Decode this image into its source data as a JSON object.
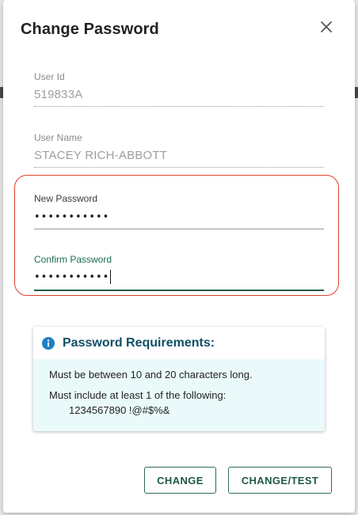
{
  "dialog": {
    "title": "Change Password"
  },
  "fields": {
    "user_id": {
      "label": "User Id",
      "value": "519833A"
    },
    "user_name": {
      "label": "User Name",
      "value": "STACEY RICH-ABBOTT"
    },
    "new_password": {
      "label": "New Password",
      "value": "•••••••••••"
    },
    "confirm_password": {
      "label": "Confirm Password",
      "value": "•••••••••••"
    }
  },
  "requirements": {
    "title": "Password Requirements:",
    "length_rule": "Must be between 10 and 20 characters long.",
    "char_rule": "Must include at least 1 of the following:",
    "allowed_chars": "1234567890 !@#$%&"
  },
  "buttons": {
    "change": "CHANGE",
    "change_test": "CHANGE/TEST"
  },
  "colors": {
    "accent": "#1b5e4a",
    "highlight_outline": "#e0412b",
    "info_icon": "#1e7fc4",
    "requirements_bg": "#eafafa"
  },
  "icons": {
    "close": "close-icon",
    "info": "info-icon"
  }
}
